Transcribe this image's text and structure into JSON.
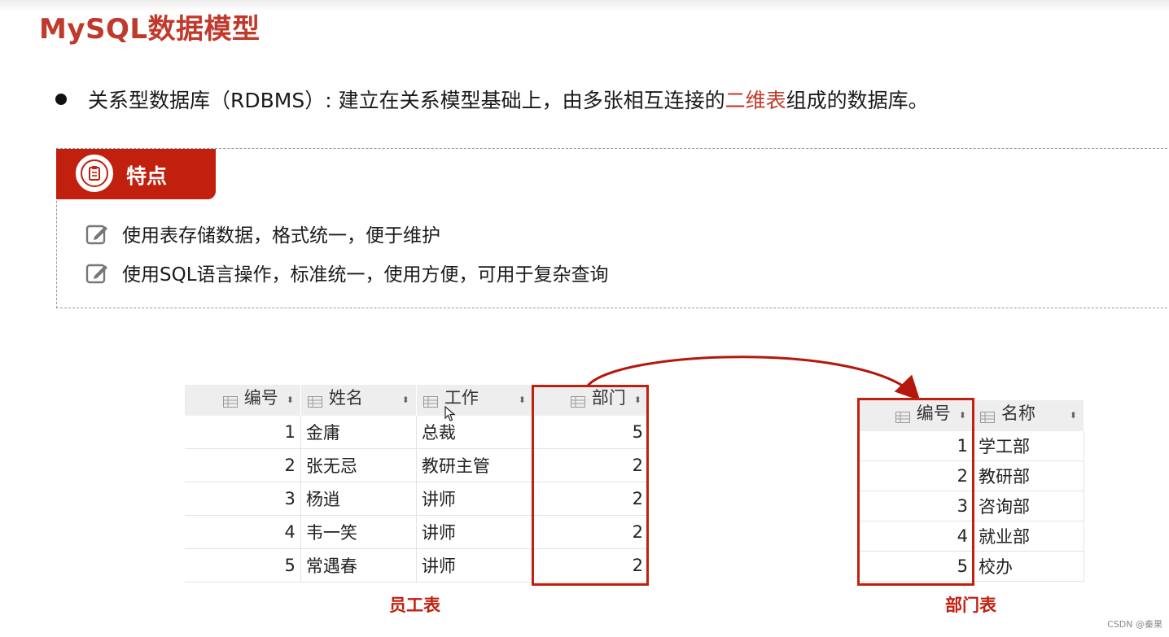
{
  "page": {
    "title": "MySQL数据模型",
    "bullet": {
      "prefix": "关系型数据库（RDBMS）: 建立在关系模型基础上，由多张相互连接的",
      "highlight": "二维表",
      "suffix": "组成的数据库。"
    },
    "features": {
      "tag_label": "特点",
      "items": [
        "使用表存储数据，格式统一，便于维护",
        "使用SQL语言操作，标准统一，使用方便，可用于复杂查询"
      ]
    },
    "watermark": "CSDN @秦果"
  },
  "employee_table": {
    "caption": "员工表",
    "columns": [
      "编号",
      "姓名",
      "工作",
      "部门"
    ],
    "rows": [
      [
        "1",
        "金庸",
        "总裁",
        "5"
      ],
      [
        "2",
        "张无忌",
        "教研主管",
        "2"
      ],
      [
        "3",
        "杨逍",
        "讲师",
        "2"
      ],
      [
        "4",
        "韦一笑",
        "讲师",
        "2"
      ],
      [
        "5",
        "常遇春",
        "讲师",
        "2"
      ]
    ]
  },
  "department_table": {
    "caption": "部门表",
    "columns": [
      "编号",
      "名称"
    ],
    "rows": [
      [
        "1",
        "学工部"
      ],
      [
        "2",
        "教研部"
      ],
      [
        "3",
        "咨询部"
      ],
      [
        "4",
        "就业部"
      ],
      [
        "5",
        "校办"
      ]
    ]
  },
  "colors": {
    "accent": "#c1200f",
    "title": "#c0392b",
    "header_bg": "#eeeeee"
  },
  "icons": [
    "clipboard-icon",
    "edit-icon",
    "column-icon",
    "sort-icon",
    "cursor-icon"
  ]
}
